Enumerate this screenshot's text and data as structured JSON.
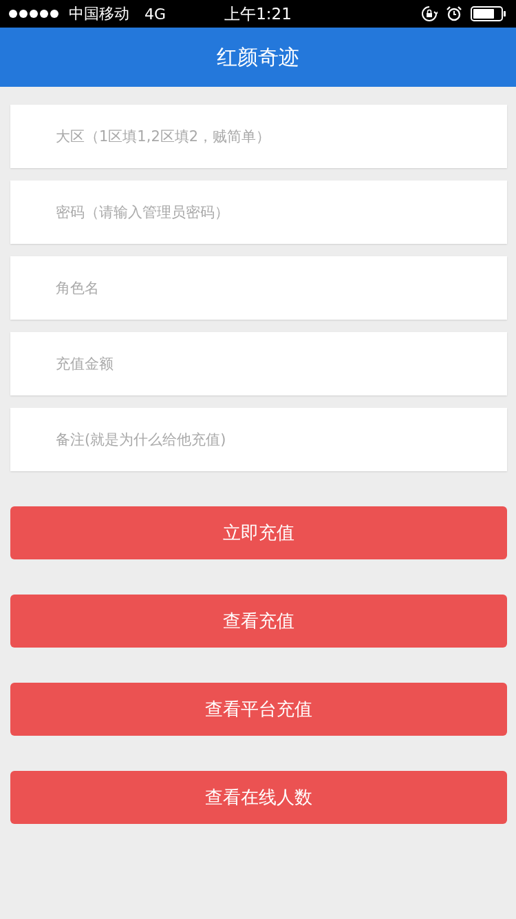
{
  "status_bar": {
    "carrier": "中国移动",
    "network": "4G",
    "time": "上午1:21"
  },
  "header": {
    "title": "红颜奇迹"
  },
  "fields": [
    {
      "placeholder": "大区（1区填1,2区填2，贼简单）"
    },
    {
      "placeholder": "密码（请输入管理员密码）"
    },
    {
      "placeholder": "角色名"
    },
    {
      "placeholder": "充值金额"
    },
    {
      "placeholder": "备注(就是为什么给他充值)"
    }
  ],
  "buttons": [
    "立即充值",
    "查看充值",
    "查看平台充值",
    "查看在线人数"
  ]
}
